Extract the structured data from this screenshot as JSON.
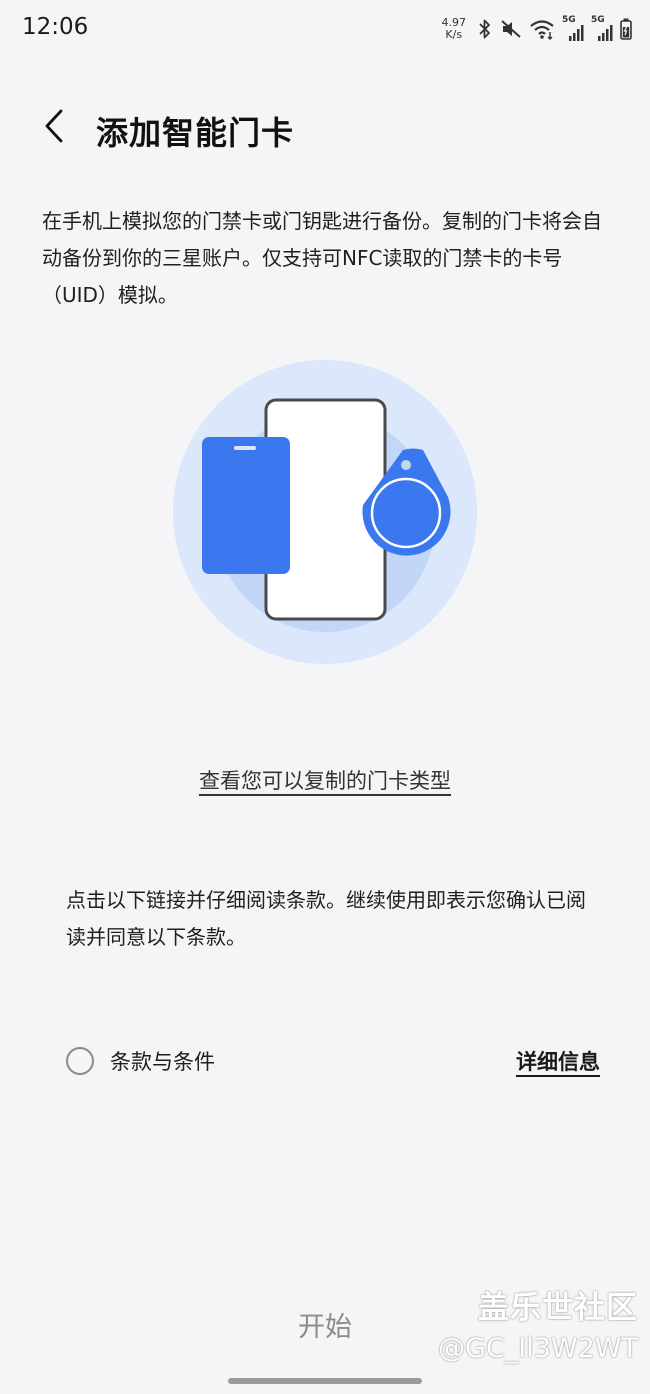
{
  "status_bar": {
    "time": "12:06",
    "net_speed_value": "4.97",
    "net_speed_unit": "K/s",
    "sim1_label": "5G",
    "sim2_label": "5G"
  },
  "header": {
    "title": "添加智能门卡"
  },
  "description": "在手机上模拟您的门禁卡或门钥匙进行备份。复制的门卡将会自动备份到你的三星账户。仅支持可NFC读取的门禁卡的卡号（UID）模拟。",
  "card_types_link": "查看您可以复制的门卡类型",
  "terms_notice": "点击以下链接并仔细阅读条款。继续使用即表示您确认已阅读并同意以下条款。",
  "terms": {
    "label": "条款与条件",
    "checked": false,
    "details_link": "详细信息"
  },
  "start_button": "开始",
  "watermark": {
    "line1": "盖乐世社区",
    "line2": "@GC_Il3W2WT"
  },
  "colors": {
    "background": "#f5f5f7",
    "accent_blue": "#3b78f0",
    "circle_light": "#dbe7fb",
    "circle_mid": "#c2d6f8",
    "button_disabled": "#8c8c8c"
  },
  "icons": {
    "back": "chevron-left-icon",
    "bluetooth": "bluetooth-icon",
    "mute": "mute-icon",
    "wifi": "wifi-icon",
    "signal": "signal-icon",
    "battery": "battery-icon"
  }
}
